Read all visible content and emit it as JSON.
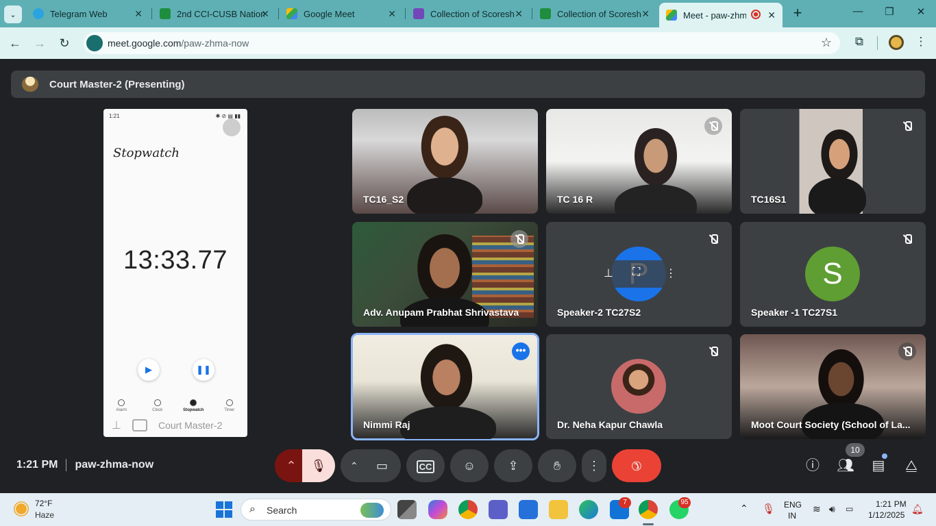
{
  "browser": {
    "tabs": [
      {
        "label": "Telegram Web",
        "favicon_color": "#2aa3e0"
      },
      {
        "label": "2nd CCI-CUSB Nation",
        "favicon_color": "#1e8e3e"
      },
      {
        "label": "Google Meet",
        "favicon_color": "#00897b"
      },
      {
        "label": "Collection of Scoresh",
        "favicon_color": "#7248b9"
      },
      {
        "label": "Collection of Scoresh",
        "favicon_color": "#1e8e3e"
      },
      {
        "label": "Meet - paw-zhma",
        "favicon_color": "#00897b"
      }
    ],
    "new_tab": "+",
    "window": {
      "minimize": "—",
      "restore": "❐",
      "close": "✕"
    },
    "url_host": "meet.google.com",
    "url_path": "/paw-zhma-now"
  },
  "meet": {
    "presenter_banner": "Court Master-2 (Presenting)",
    "shared_screen": {
      "status_time": "1:21",
      "app_title": "Stopwatch",
      "elapsed": "13:33.77",
      "nav_tabs": [
        "Alarm",
        "Clock",
        "Stopwatch",
        "Timer"
      ],
      "overlay_label": "Court Master-2"
    },
    "participants": [
      {
        "name": "TC16_S2",
        "muted": false
      },
      {
        "name": "TC 16 R",
        "muted": true
      },
      {
        "name": "TC16S1",
        "muted": true
      },
      {
        "name": "Adv. Anupam Prabhat Shrivastava",
        "muted": true
      },
      {
        "name": "Speaker-2 TC27S2",
        "muted": true,
        "initial": "P",
        "avatar_color": "#1a73e8"
      },
      {
        "name": "Speaker -1 TC27S1",
        "muted": true,
        "initial": "S",
        "avatar_color": "#5f9e32"
      },
      {
        "name": "Nimmi Raj",
        "muted": false,
        "more": "•••"
      },
      {
        "name": "Dr. Neha Kapur Chawla",
        "muted": true
      },
      {
        "name": "Moot Court Society (School of La...",
        "muted": true
      }
    ],
    "time": "1:21 PM",
    "meeting_code": "paw-zhma-now",
    "people_count": "10"
  },
  "taskbar": {
    "temperature": "72°F",
    "weather": "Haze",
    "search_placeholder": "Search",
    "outlook_badge": "7",
    "whatsapp_badge": "95",
    "lang_top": "ENG",
    "lang_bottom": "IN",
    "clock_time": "1:21 PM",
    "clock_date": "1/12/2025"
  }
}
